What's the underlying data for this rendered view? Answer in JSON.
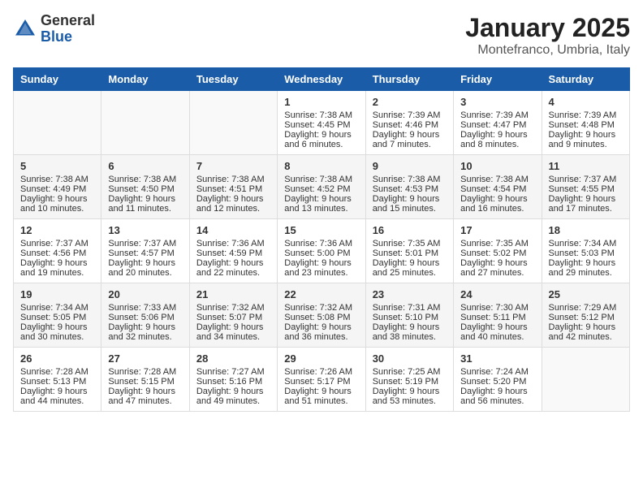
{
  "header": {
    "logo_general": "General",
    "logo_blue": "Blue",
    "month_title": "January 2025",
    "location": "Montefranco, Umbria, Italy"
  },
  "days_of_week": [
    "Sunday",
    "Monday",
    "Tuesday",
    "Wednesday",
    "Thursday",
    "Friday",
    "Saturday"
  ],
  "weeks": [
    {
      "cells": [
        {
          "day": "",
          "sunrise": "",
          "sunset": "",
          "daylight": ""
        },
        {
          "day": "",
          "sunrise": "",
          "sunset": "",
          "daylight": ""
        },
        {
          "day": "",
          "sunrise": "",
          "sunset": "",
          "daylight": ""
        },
        {
          "day": "1",
          "sunrise": "Sunrise: 7:38 AM",
          "sunset": "Sunset: 4:45 PM",
          "daylight": "Daylight: 9 hours and 6 minutes."
        },
        {
          "day": "2",
          "sunrise": "Sunrise: 7:39 AM",
          "sunset": "Sunset: 4:46 PM",
          "daylight": "Daylight: 9 hours and 7 minutes."
        },
        {
          "day": "3",
          "sunrise": "Sunrise: 7:39 AM",
          "sunset": "Sunset: 4:47 PM",
          "daylight": "Daylight: 9 hours and 8 minutes."
        },
        {
          "day": "4",
          "sunrise": "Sunrise: 7:39 AM",
          "sunset": "Sunset: 4:48 PM",
          "daylight": "Daylight: 9 hours and 9 minutes."
        }
      ]
    },
    {
      "cells": [
        {
          "day": "5",
          "sunrise": "Sunrise: 7:38 AM",
          "sunset": "Sunset: 4:49 PM",
          "daylight": "Daylight: 9 hours and 10 minutes."
        },
        {
          "day": "6",
          "sunrise": "Sunrise: 7:38 AM",
          "sunset": "Sunset: 4:50 PM",
          "daylight": "Daylight: 9 hours and 11 minutes."
        },
        {
          "day": "7",
          "sunrise": "Sunrise: 7:38 AM",
          "sunset": "Sunset: 4:51 PM",
          "daylight": "Daylight: 9 hours and 12 minutes."
        },
        {
          "day": "8",
          "sunrise": "Sunrise: 7:38 AM",
          "sunset": "Sunset: 4:52 PM",
          "daylight": "Daylight: 9 hours and 13 minutes."
        },
        {
          "day": "9",
          "sunrise": "Sunrise: 7:38 AM",
          "sunset": "Sunset: 4:53 PM",
          "daylight": "Daylight: 9 hours and 15 minutes."
        },
        {
          "day": "10",
          "sunrise": "Sunrise: 7:38 AM",
          "sunset": "Sunset: 4:54 PM",
          "daylight": "Daylight: 9 hours and 16 minutes."
        },
        {
          "day": "11",
          "sunrise": "Sunrise: 7:37 AM",
          "sunset": "Sunset: 4:55 PM",
          "daylight": "Daylight: 9 hours and 17 minutes."
        }
      ]
    },
    {
      "cells": [
        {
          "day": "12",
          "sunrise": "Sunrise: 7:37 AM",
          "sunset": "Sunset: 4:56 PM",
          "daylight": "Daylight: 9 hours and 19 minutes."
        },
        {
          "day": "13",
          "sunrise": "Sunrise: 7:37 AM",
          "sunset": "Sunset: 4:57 PM",
          "daylight": "Daylight: 9 hours and 20 minutes."
        },
        {
          "day": "14",
          "sunrise": "Sunrise: 7:36 AM",
          "sunset": "Sunset: 4:59 PM",
          "daylight": "Daylight: 9 hours and 22 minutes."
        },
        {
          "day": "15",
          "sunrise": "Sunrise: 7:36 AM",
          "sunset": "Sunset: 5:00 PM",
          "daylight": "Daylight: 9 hours and 23 minutes."
        },
        {
          "day": "16",
          "sunrise": "Sunrise: 7:35 AM",
          "sunset": "Sunset: 5:01 PM",
          "daylight": "Daylight: 9 hours and 25 minutes."
        },
        {
          "day": "17",
          "sunrise": "Sunrise: 7:35 AM",
          "sunset": "Sunset: 5:02 PM",
          "daylight": "Daylight: 9 hours and 27 minutes."
        },
        {
          "day": "18",
          "sunrise": "Sunrise: 7:34 AM",
          "sunset": "Sunset: 5:03 PM",
          "daylight": "Daylight: 9 hours and 29 minutes."
        }
      ]
    },
    {
      "cells": [
        {
          "day": "19",
          "sunrise": "Sunrise: 7:34 AM",
          "sunset": "Sunset: 5:05 PM",
          "daylight": "Daylight: 9 hours and 30 minutes."
        },
        {
          "day": "20",
          "sunrise": "Sunrise: 7:33 AM",
          "sunset": "Sunset: 5:06 PM",
          "daylight": "Daylight: 9 hours and 32 minutes."
        },
        {
          "day": "21",
          "sunrise": "Sunrise: 7:32 AM",
          "sunset": "Sunset: 5:07 PM",
          "daylight": "Daylight: 9 hours and 34 minutes."
        },
        {
          "day": "22",
          "sunrise": "Sunrise: 7:32 AM",
          "sunset": "Sunset: 5:08 PM",
          "daylight": "Daylight: 9 hours and 36 minutes."
        },
        {
          "day": "23",
          "sunrise": "Sunrise: 7:31 AM",
          "sunset": "Sunset: 5:10 PM",
          "daylight": "Daylight: 9 hours and 38 minutes."
        },
        {
          "day": "24",
          "sunrise": "Sunrise: 7:30 AM",
          "sunset": "Sunset: 5:11 PM",
          "daylight": "Daylight: 9 hours and 40 minutes."
        },
        {
          "day": "25",
          "sunrise": "Sunrise: 7:29 AM",
          "sunset": "Sunset: 5:12 PM",
          "daylight": "Daylight: 9 hours and 42 minutes."
        }
      ]
    },
    {
      "cells": [
        {
          "day": "26",
          "sunrise": "Sunrise: 7:28 AM",
          "sunset": "Sunset: 5:13 PM",
          "daylight": "Daylight: 9 hours and 44 minutes."
        },
        {
          "day": "27",
          "sunrise": "Sunrise: 7:28 AM",
          "sunset": "Sunset: 5:15 PM",
          "daylight": "Daylight: 9 hours and 47 minutes."
        },
        {
          "day": "28",
          "sunrise": "Sunrise: 7:27 AM",
          "sunset": "Sunset: 5:16 PM",
          "daylight": "Daylight: 9 hours and 49 minutes."
        },
        {
          "day": "29",
          "sunrise": "Sunrise: 7:26 AM",
          "sunset": "Sunset: 5:17 PM",
          "daylight": "Daylight: 9 hours and 51 minutes."
        },
        {
          "day": "30",
          "sunrise": "Sunrise: 7:25 AM",
          "sunset": "Sunset: 5:19 PM",
          "daylight": "Daylight: 9 hours and 53 minutes."
        },
        {
          "day": "31",
          "sunrise": "Sunrise: 7:24 AM",
          "sunset": "Sunset: 5:20 PM",
          "daylight": "Daylight: 9 hours and 56 minutes."
        },
        {
          "day": "",
          "sunrise": "",
          "sunset": "",
          "daylight": ""
        }
      ]
    }
  ]
}
